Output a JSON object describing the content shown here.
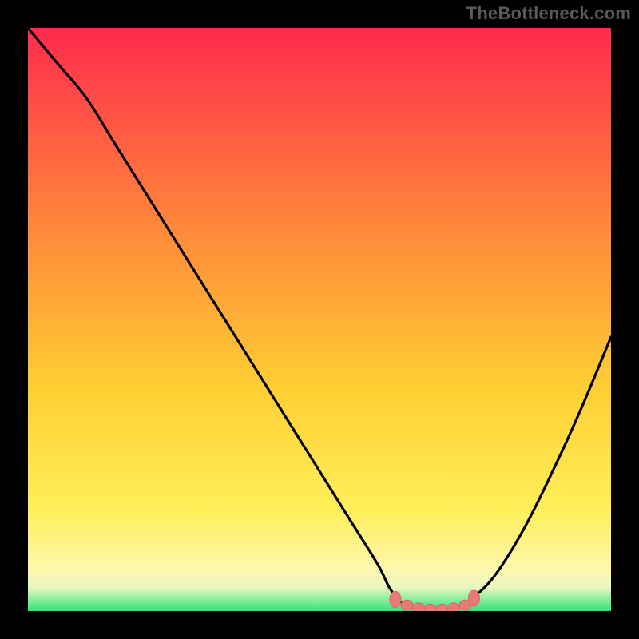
{
  "attribution": "TheBottleneck.com",
  "colors": {
    "gradient_top": "#ff2a4d",
    "gradient_upper": "#ff6a3a",
    "gradient_mid": "#ffcf33",
    "gradient_lower_yellow": "#ffef5a",
    "gradient_pale": "#fdf7b0",
    "gradient_green": "#2ee57a",
    "curve_stroke": "#000000",
    "marker_fill": "#e77b77",
    "marker_stroke": "#d86864",
    "background": "#000000"
  },
  "chart_data": {
    "type": "line",
    "title": "",
    "xlabel": "",
    "ylabel": "",
    "x": [
      0,
      5,
      10,
      15,
      20,
      25,
      30,
      35,
      40,
      45,
      50,
      55,
      60,
      62,
      64,
      66,
      68,
      70,
      72,
      74,
      76,
      80,
      85,
      90,
      95,
      100
    ],
    "values": [
      100,
      94,
      88,
      80,
      72,
      64,
      56,
      48,
      40,
      32,
      24,
      16,
      8,
      4,
      1.5,
      0.5,
      0,
      0,
      0,
      0.5,
      2,
      6,
      14,
      24,
      35,
      47
    ],
    "xlim": [
      0,
      100
    ],
    "ylim": [
      0,
      100
    ],
    "flat_region_x": [
      66,
      75
    ],
    "flat_marker_x": [
      63,
      65,
      67,
      69,
      71,
      73,
      75,
      76.5
    ],
    "flat_marker_y": [
      2.0,
      1.0,
      0.5,
      0.3,
      0.3,
      0.5,
      1.0,
      2.2
    ]
  }
}
